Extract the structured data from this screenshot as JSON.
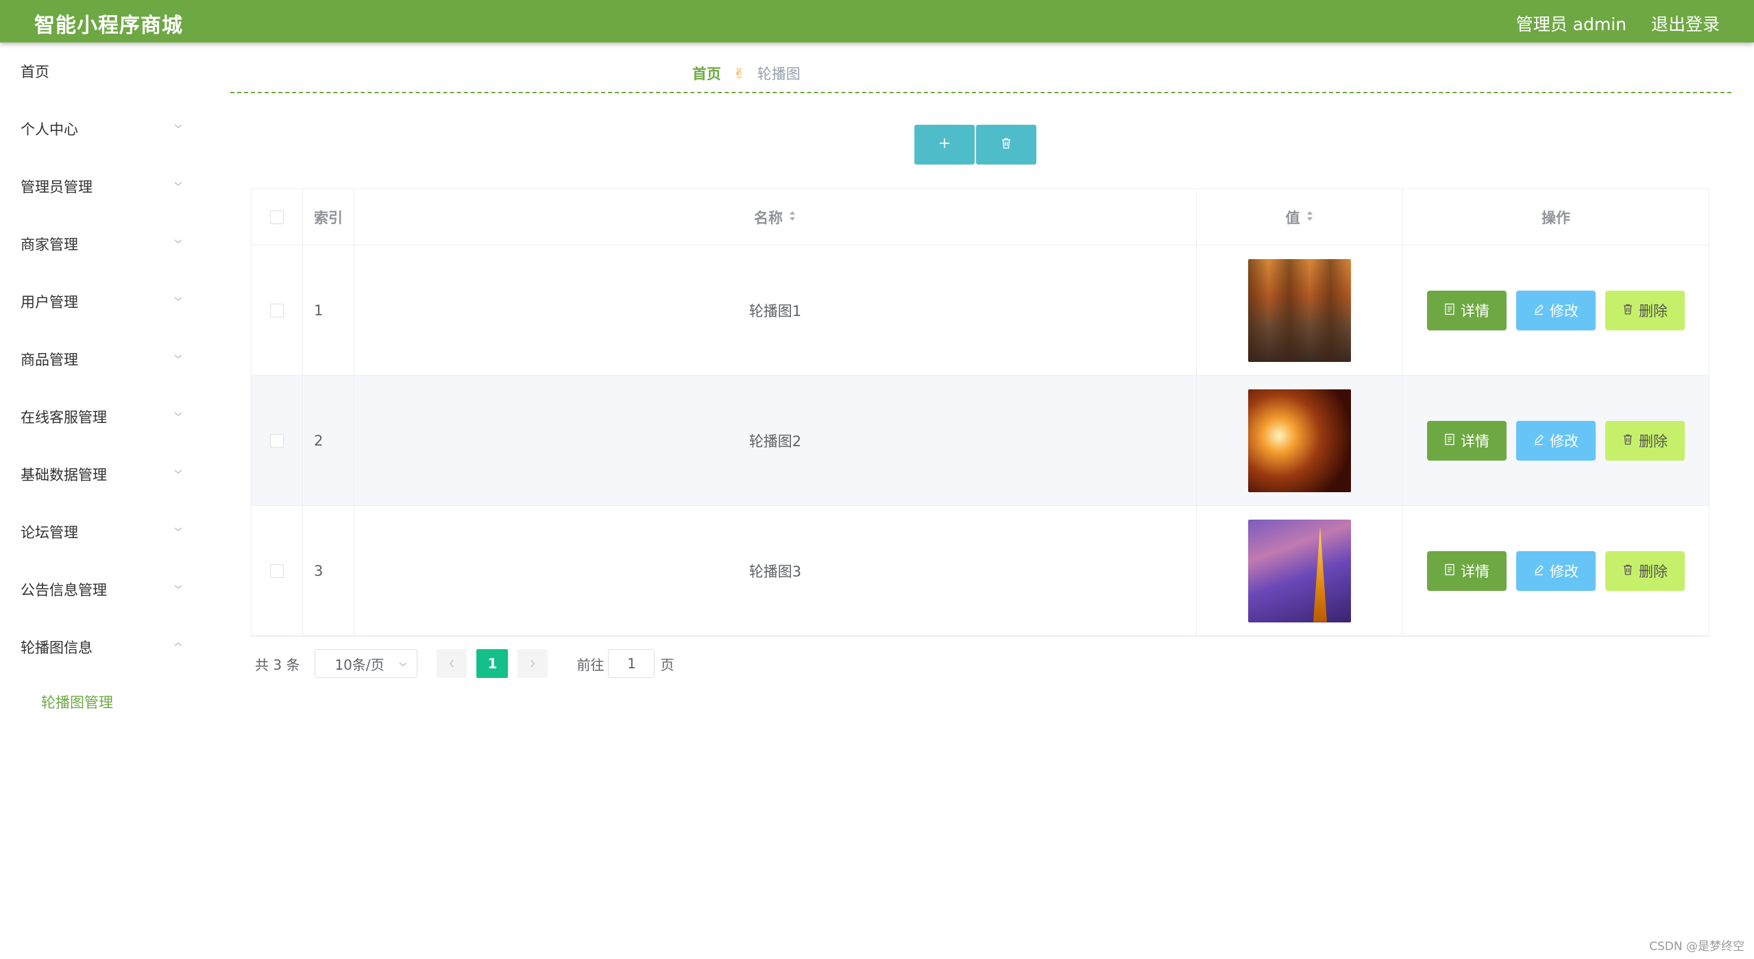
{
  "header": {
    "title": "智能小程序商城",
    "user_label": "管理员 admin",
    "logout_label": "退出登录"
  },
  "sidebar": {
    "items": [
      {
        "label": "首页",
        "has_arrow": false
      },
      {
        "label": "个人中心",
        "has_arrow": true,
        "expanded": false
      },
      {
        "label": "管理员管理",
        "has_arrow": true,
        "expanded": false
      },
      {
        "label": "商家管理",
        "has_arrow": true,
        "expanded": false
      },
      {
        "label": "用户管理",
        "has_arrow": true,
        "expanded": false
      },
      {
        "label": "商品管理",
        "has_arrow": true,
        "expanded": false
      },
      {
        "label": "在线客服管理",
        "has_arrow": true,
        "expanded": false
      },
      {
        "label": "基础数据管理",
        "has_arrow": true,
        "expanded": false
      },
      {
        "label": "论坛管理",
        "has_arrow": true,
        "expanded": false
      },
      {
        "label": "公告信息管理",
        "has_arrow": true,
        "expanded": false
      },
      {
        "label": "轮播图信息",
        "has_arrow": true,
        "expanded": true
      }
    ],
    "submenu": {
      "label": "轮播图管理",
      "active": true
    }
  },
  "breadcrumb": {
    "home": "首页",
    "separator_icon": "victory-hand-icon",
    "current": "轮播图"
  },
  "toolbar": {
    "add_icon": "plus-icon",
    "delete_icon": "trash-icon"
  },
  "table": {
    "headers": {
      "index": "索引",
      "name": "名称",
      "value": "值",
      "ops": "操作"
    },
    "rows": [
      {
        "index": "1",
        "name": "轮播图1",
        "image": "street-night-photo"
      },
      {
        "index": "2",
        "name": "轮播图2",
        "image": "lantern-street-photo"
      },
      {
        "index": "3",
        "name": "轮播图3",
        "image": "tower-night-photo"
      }
    ],
    "actions": {
      "detail": "详情",
      "edit": "修改",
      "delete": "删除"
    }
  },
  "pagination": {
    "total_label": "共 3 条",
    "page_size": "10条/页",
    "current_page": "1",
    "goto_label": "前往",
    "goto_value": "1",
    "page_suffix": "页"
  },
  "watermark": "CSDN @是梦终空",
  "colors": {
    "brand": "#6ea843",
    "toolbar_button": "#4fbcc9",
    "detail_button": "#6ea843",
    "edit_button": "#66c4f7",
    "delete_button": "#c6f06a",
    "active_page": "#13c08a"
  }
}
